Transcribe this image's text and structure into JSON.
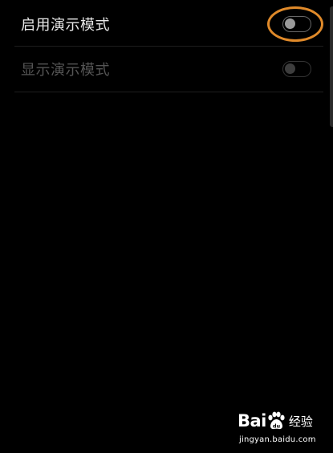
{
  "settings": {
    "rows": [
      {
        "label": "启用演示模式",
        "enabled": true,
        "toggle_on": false
      },
      {
        "label": "显示演示模式",
        "enabled": false,
        "toggle_on": false
      }
    ]
  },
  "annotation": {
    "color": "#e08a2a"
  },
  "watermark": {
    "logo_prefix": "Bai",
    "logo_du": "du",
    "logo_suffix": "经验",
    "url": "jingyan.baidu.com"
  },
  "colors": {
    "background": "#000000",
    "label_enabled": "#e8e8e8",
    "label_disabled": "#555555"
  }
}
